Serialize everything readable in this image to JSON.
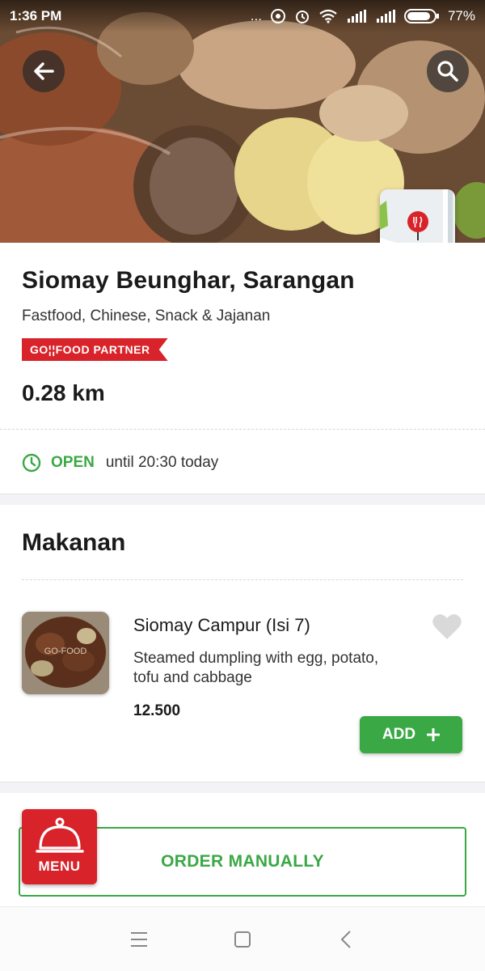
{
  "status_bar": {
    "time": "1:36 PM",
    "dots": "...",
    "battery": "77%",
    "icons": [
      "notification-icon",
      "alarm-icon",
      "wifi-icon",
      "signal-icon",
      "signal-icon",
      "battery-icon"
    ]
  },
  "header": {
    "back_icon": "arrow-left-icon",
    "search_icon": "search-icon",
    "map_icon": "restaurant-pin-icon"
  },
  "restaurant": {
    "name": "Siomay Beunghar, Sarangan",
    "categories": "Fastfood, Chinese, Snack & Jajanan",
    "badge": "GO¦¦FOOD PARTNER",
    "distance": "0.28 km",
    "status": "OPEN",
    "hours_text": "until 20:30 today",
    "clock_icon": "clock-icon"
  },
  "menu_section": {
    "title": "Makanan",
    "items": [
      {
        "name": "Siomay Campur (Isi 7)",
        "description": "Steamed dumpling with egg, potato, tofu and cabbage",
        "price": "12.500",
        "add_label": "ADD",
        "add_icon": "plus-icon",
        "favorite_icon": "heart-icon",
        "thumb_watermark": "GO-FOOD"
      }
    ]
  },
  "order": {
    "menu_label": "MENU",
    "order_label": "ORDER MANUALLY"
  },
  "navbar": {
    "icons": [
      "menu-icon",
      "home-square-icon",
      "back-chevron-icon"
    ]
  },
  "colors": {
    "green": "#3aa845",
    "red": "#d8232a",
    "text": "#1a1a1a"
  }
}
